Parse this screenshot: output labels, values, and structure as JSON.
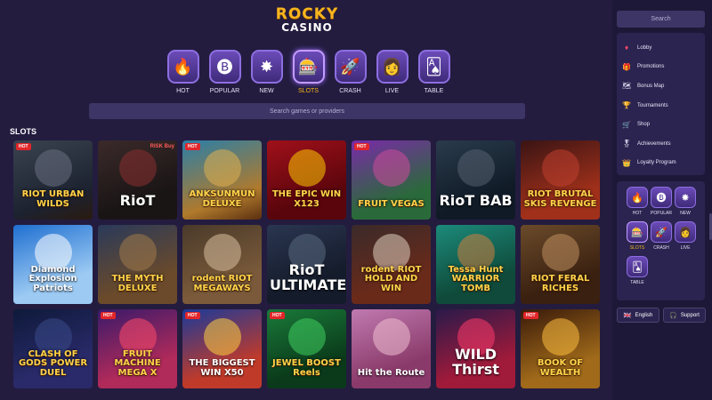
{
  "brand": {
    "line1": "ROCKY",
    "line2": "CASINO"
  },
  "categories": [
    {
      "label": "HOT",
      "icon": "🔥"
    },
    {
      "label": "POPULAR",
      "icon": "🅑"
    },
    {
      "label": "NEW",
      "icon": "✸"
    },
    {
      "label": "SLOTS",
      "icon": "🎰"
    },
    {
      "label": "CRASH",
      "icon": "🚀"
    },
    {
      "label": "LIVE",
      "icon": "👩"
    },
    {
      "label": "TABLE",
      "icon": "🂡"
    }
  ],
  "search": {
    "placeholder": "Search games or providers"
  },
  "section_title": "SLOTS",
  "hot_label": "HOT",
  "games": [
    {
      "title": "RIOT URBAN WILDS",
      "hot": true
    },
    {
      "title": "RioT",
      "hot": false,
      "extra": "RISK Buy"
    },
    {
      "title": "ANKSUNMUN DELUXE",
      "hot": true
    },
    {
      "title": "THE EPIC WIN X123",
      "hot": false
    },
    {
      "title": "FRUIT VEGAS",
      "hot": true
    },
    {
      "title": "RioT BAB",
      "hot": false
    },
    {
      "title": "RIOT BRUTAL SKIS REVENGE",
      "hot": false
    },
    {
      "title": "Diamond Explosion Patriots",
      "hot": false
    },
    {
      "title": "THE MYTH DELUXE",
      "hot": false
    },
    {
      "title": "rodent RIOT MEGAWAYS",
      "hot": false
    },
    {
      "title": "RioT ULTIMATE",
      "hot": false
    },
    {
      "title": "rodent RIOT HOLD AND WIN",
      "hot": false
    },
    {
      "title": "Tessa Hunt WARRIOR TOMB",
      "hot": false
    },
    {
      "title": "RIOT FERAL RICHES",
      "hot": false
    },
    {
      "title": "CLASH OF GODS POWER DUEL",
      "hot": false
    },
    {
      "title": "FRUIT MACHINE MEGA X",
      "hot": true
    },
    {
      "title": "THE BIGGEST WIN X50",
      "hot": true
    },
    {
      "title": "JEWEL BOOST Reels",
      "hot": true
    },
    {
      "title": "Hit the Route",
      "hot": false
    },
    {
      "title": "WILD Thirst",
      "hot": false
    },
    {
      "title": "BOOK OF WEALTH",
      "hot": true
    }
  ],
  "sidebar": {
    "search_placeholder": "Search",
    "menu": [
      {
        "label": "Lobby",
        "icon": "♦"
      },
      {
        "label": "Promotions",
        "icon": "🎁"
      },
      {
        "label": "Bonus Map",
        "icon": "🗺"
      },
      {
        "label": "Tournaments",
        "icon": "🏆"
      },
      {
        "label": "Shop",
        "icon": "🛒"
      },
      {
        "label": "Achievements",
        "icon": "🎖"
      },
      {
        "label": "Loyalty Program",
        "icon": "👑"
      }
    ],
    "quick": [
      {
        "label": "HOT",
        "icon": "🔥"
      },
      {
        "label": "POPULAR",
        "icon": "🅑"
      },
      {
        "label": "NEW",
        "icon": "✸"
      },
      {
        "label": "SLOTS",
        "icon": "🎰"
      },
      {
        "label": "CRASH",
        "icon": "🚀"
      },
      {
        "label": "LIVE",
        "icon": "👩"
      },
      {
        "label": "TABLE",
        "icon": "🂡"
      }
    ],
    "language": "English",
    "language_icon": "🇬🇧",
    "support": "Support",
    "support_icon": "🎧"
  },
  "colors": {
    "accent": "#f7b51e",
    "background": "#231c3f",
    "panel": "#2b2450",
    "hot_badge": "#e2262a"
  }
}
